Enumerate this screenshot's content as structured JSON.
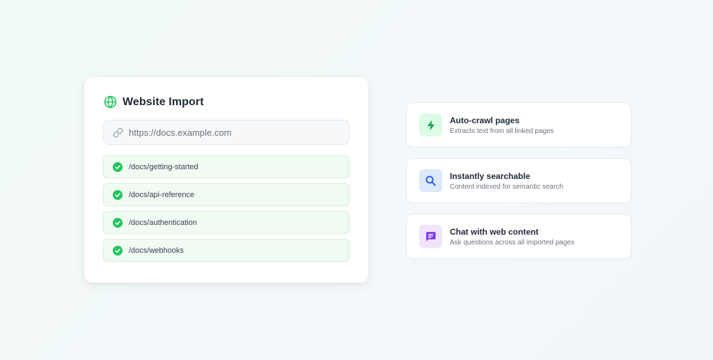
{
  "import_card": {
    "title": "Website Import",
    "url_field": {
      "value": "",
      "placeholder": "https://docs.example.com"
    },
    "pages": [
      {
        "path": "/docs/getting-started",
        "status": "imported"
      },
      {
        "path": "/docs/api-reference",
        "status": "imported"
      },
      {
        "path": "/docs/authentication",
        "status": "imported"
      },
      {
        "path": "/docs/webhooks",
        "status": "imported"
      }
    ]
  },
  "features": [
    {
      "title": "Auto-crawl pages",
      "description": "Extracts text from all linked pages",
      "icon": "lightning-bolt-icon",
      "accent": "#22c55e"
    },
    {
      "title": "Instantly searchable",
      "description": "Content indexed for semantic search",
      "icon": "search-icon",
      "accent": "#3b82f6"
    },
    {
      "title": "Chat with web content",
      "description": "Ask questions across all imported pages",
      "icon": "chat-message-icon",
      "accent": "#8b5cf6"
    }
  ],
  "colors": {
    "success": "#22c55e",
    "success_bg": "#f0fbf2",
    "text_primary": "#1f2937",
    "text_muted": "#6b7280"
  }
}
